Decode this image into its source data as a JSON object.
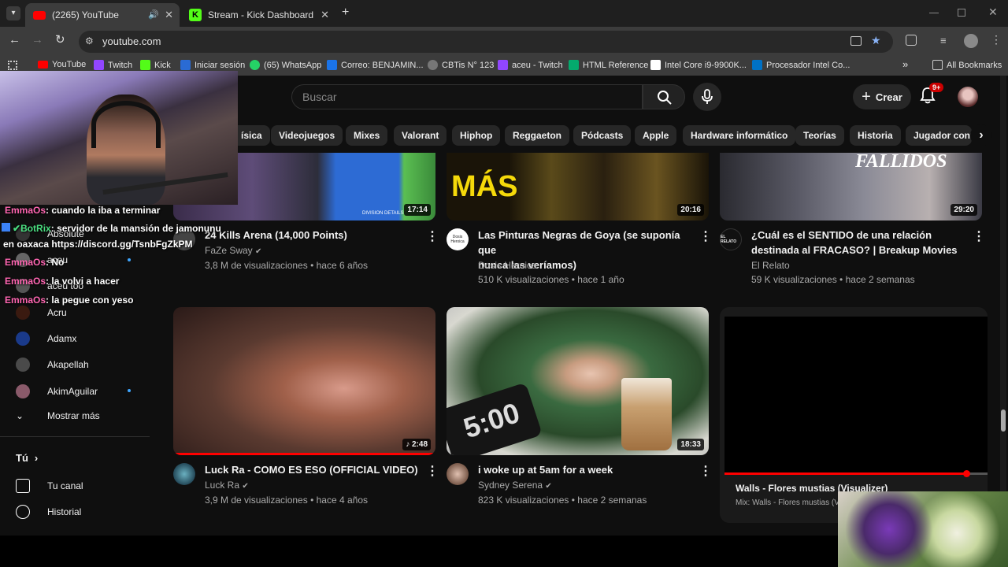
{
  "browser": {
    "tabs": [
      {
        "label": "(2265) YouTube",
        "close": "✕"
      },
      {
        "label": "Stream - Kick Dashboard",
        "close": "✕"
      }
    ],
    "new_tab": "+",
    "url": "youtube.com",
    "bookmarks": [
      "YouTube",
      "Twitch",
      "Kick",
      "Iniciar sesión",
      "(65) WhatsApp",
      "Correo: BENJAMIN...",
      "CBTis N° 123",
      "aceu - Twitch",
      "HTML Reference",
      "Intel Core i9-9900K...",
      "Procesador Intel Co..."
    ],
    "all_bookmarks": "All Bookmarks",
    "more_bookmarks": "»"
  },
  "youtube": {
    "search_placeholder": "Buscar",
    "create_label": "Crear",
    "notif_badge": "9+",
    "chips": [
      "ísica",
      "Videojuegos",
      "Mixes",
      "Valorant",
      "Hiphop",
      "Reggaeton",
      "Pódcasts",
      "Apple",
      "Hardware informático",
      "Teorías",
      "Historia",
      "Jugador cont"
    ],
    "videos_row1": [
      {
        "duration": "17:14",
        "title": "24 Kills Arena (14,000 Points)",
        "channel": "FaZe Sway",
        "meta": "3,8 M de visualizaciones • hace 6 años",
        "thumb_text": "DIVISION DETAILS"
      },
      {
        "duration": "20:16",
        "title": "Las Pinturas Negras de Goya (se suponía que",
        "title2": "nunca las veríamos)",
        "channel": "Dosis Heroica",
        "meta": "510 K visualizaciones • hace 1 año",
        "thumb_text": "MÁS",
        "avatar_text": "Dosis Heroica"
      },
      {
        "duration": "29:20",
        "title": "¿Cuál es el SENTIDO de una relación",
        "title2": "destinada al FRACASO? | Breakup Movies",
        "channel": "El Relato",
        "meta": "59 K visualizaciones • hace 2 semanas",
        "thumb_text": "FALLIDOS",
        "avatar_text": "EL RELATO"
      }
    ],
    "videos_row2": [
      {
        "duration": "2:48",
        "title": "Luck Ra - COMO ES ESO (OFFICIAL VIDEO)",
        "channel": "Luck Ra",
        "meta": "3,9 M de visualizaciones • hace 4 años"
      },
      {
        "duration": "18:33",
        "title": "i woke up at 5am for a week",
        "channel": "Sydney Serena",
        "meta": "823 K visualizaciones • hace 2 semanas",
        "thumb_text": "5:00"
      },
      {
        "title": "Walls - Flores mustias (Visualizer)",
        "meta": "Mix: Walls - Flores mustias (V"
      }
    ],
    "sidebar": {
      "channels": [
        "Absolute",
        "aceu",
        "aceu too",
        "Acru",
        "Adamx",
        "Akapellah",
        "AkimAguilar"
      ],
      "show_more": "Mostrar más",
      "you_section": "Tú",
      "your_channel": "Tu canal",
      "history": "Historial"
    }
  },
  "chat": [
    {
      "nick": "EmmaOs",
      "text": ": cuando la iba a terminar"
    },
    {
      "nick": "BotRix",
      "text": ": servidor de la mansión de jamonunu"
    },
    {
      "nick": "",
      "text": "en oaxaca https://discord.gg/TsnbFgZkPM"
    },
    {
      "nick": "EmmaOs",
      "text": ": No"
    },
    {
      "nick": "EmmaOs",
      "text": ": la volvi a hacer"
    },
    {
      "nick": "EmmaOs",
      "text": ": la pegue con yeso"
    }
  ],
  "colors": {
    "yt_red": "#ff0000",
    "kick_green": "#53fc18",
    "bg": "#0f0f0f"
  }
}
